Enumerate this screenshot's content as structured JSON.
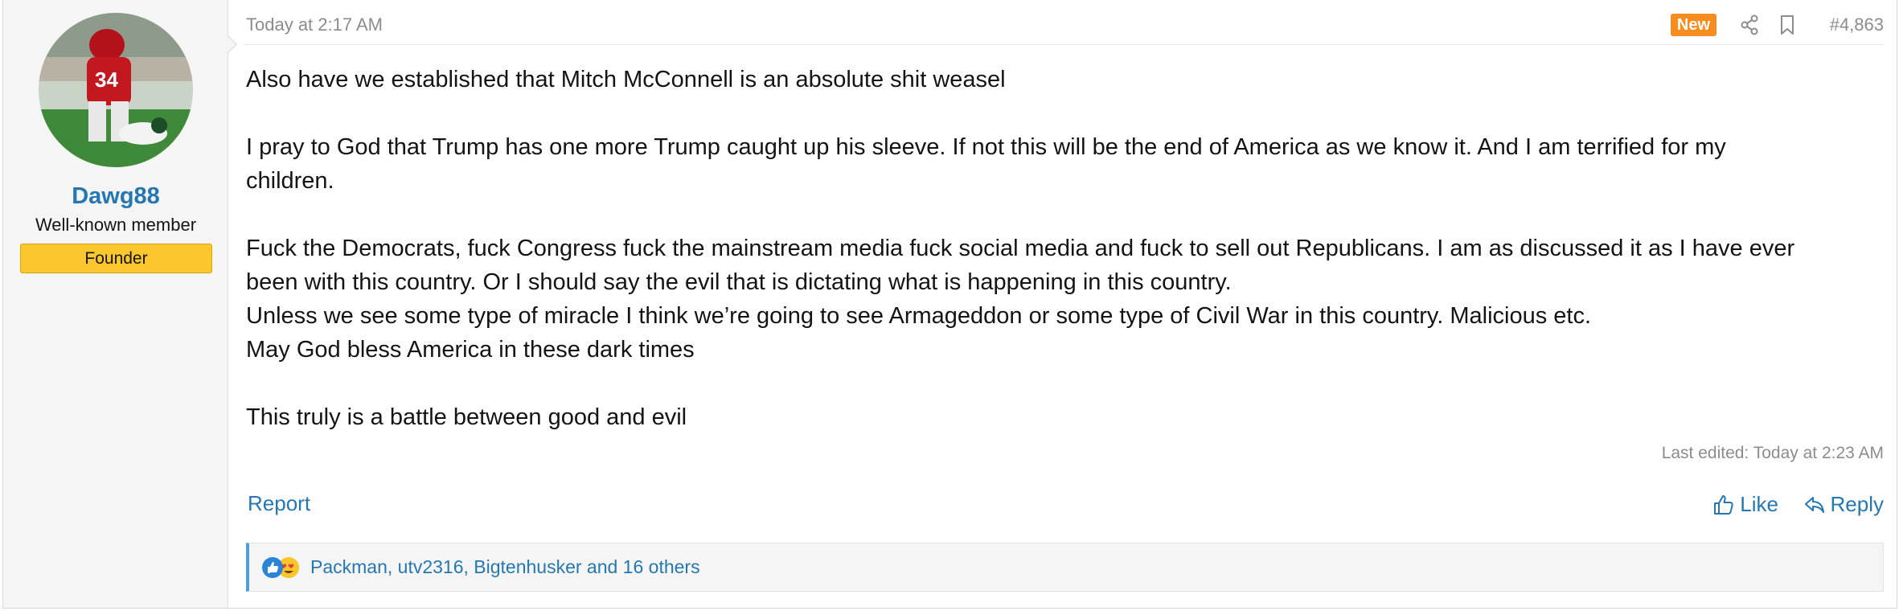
{
  "user": {
    "name": "Dawg88",
    "title": "Well-known member",
    "banner": "Founder"
  },
  "post": {
    "date": "Today at 2:17 AM",
    "new_badge": "New",
    "number": "#4,863",
    "paragraphs": [
      "Also have we established that Mitch McConnell is an absolute shit weasel",
      "",
      "I pray to God that Trump has one more Trump caught up his sleeve. If not this will be the end of America as we know it. And I am terrified for my\nchildren.",
      "",
      "Fuck the Democrats, fuck Congress fuck the mainstream media fuck social media and fuck to sell out Republicans. I am as discussed it as I have ever\nbeen with this country. Or I should say the evil that is dictating what is happening in this country.",
      "Unless we see some type of miracle I think we’re going to see Armageddon or some type of Civil War in this country. Malicious etc.",
      "May God bless America in these dark times",
      "",
      "This truly is a battle between good and evil"
    ],
    "last_edited": "Last edited: Today at 2:23 AM"
  },
  "actions": {
    "report": "Report",
    "like": "Like",
    "reply": "Reply"
  },
  "reactions": {
    "text": "Packman, utv2316, Bigtenhusker and 16 others",
    "icons": [
      "thumbs-up-reaction-icon",
      "love-reaction-icon"
    ]
  },
  "colors": {
    "link": "#2577b1",
    "banner": "#fcc72e",
    "new_badge": "#f78c1f",
    "reaction_bar_accent": "#4ea0d8"
  }
}
